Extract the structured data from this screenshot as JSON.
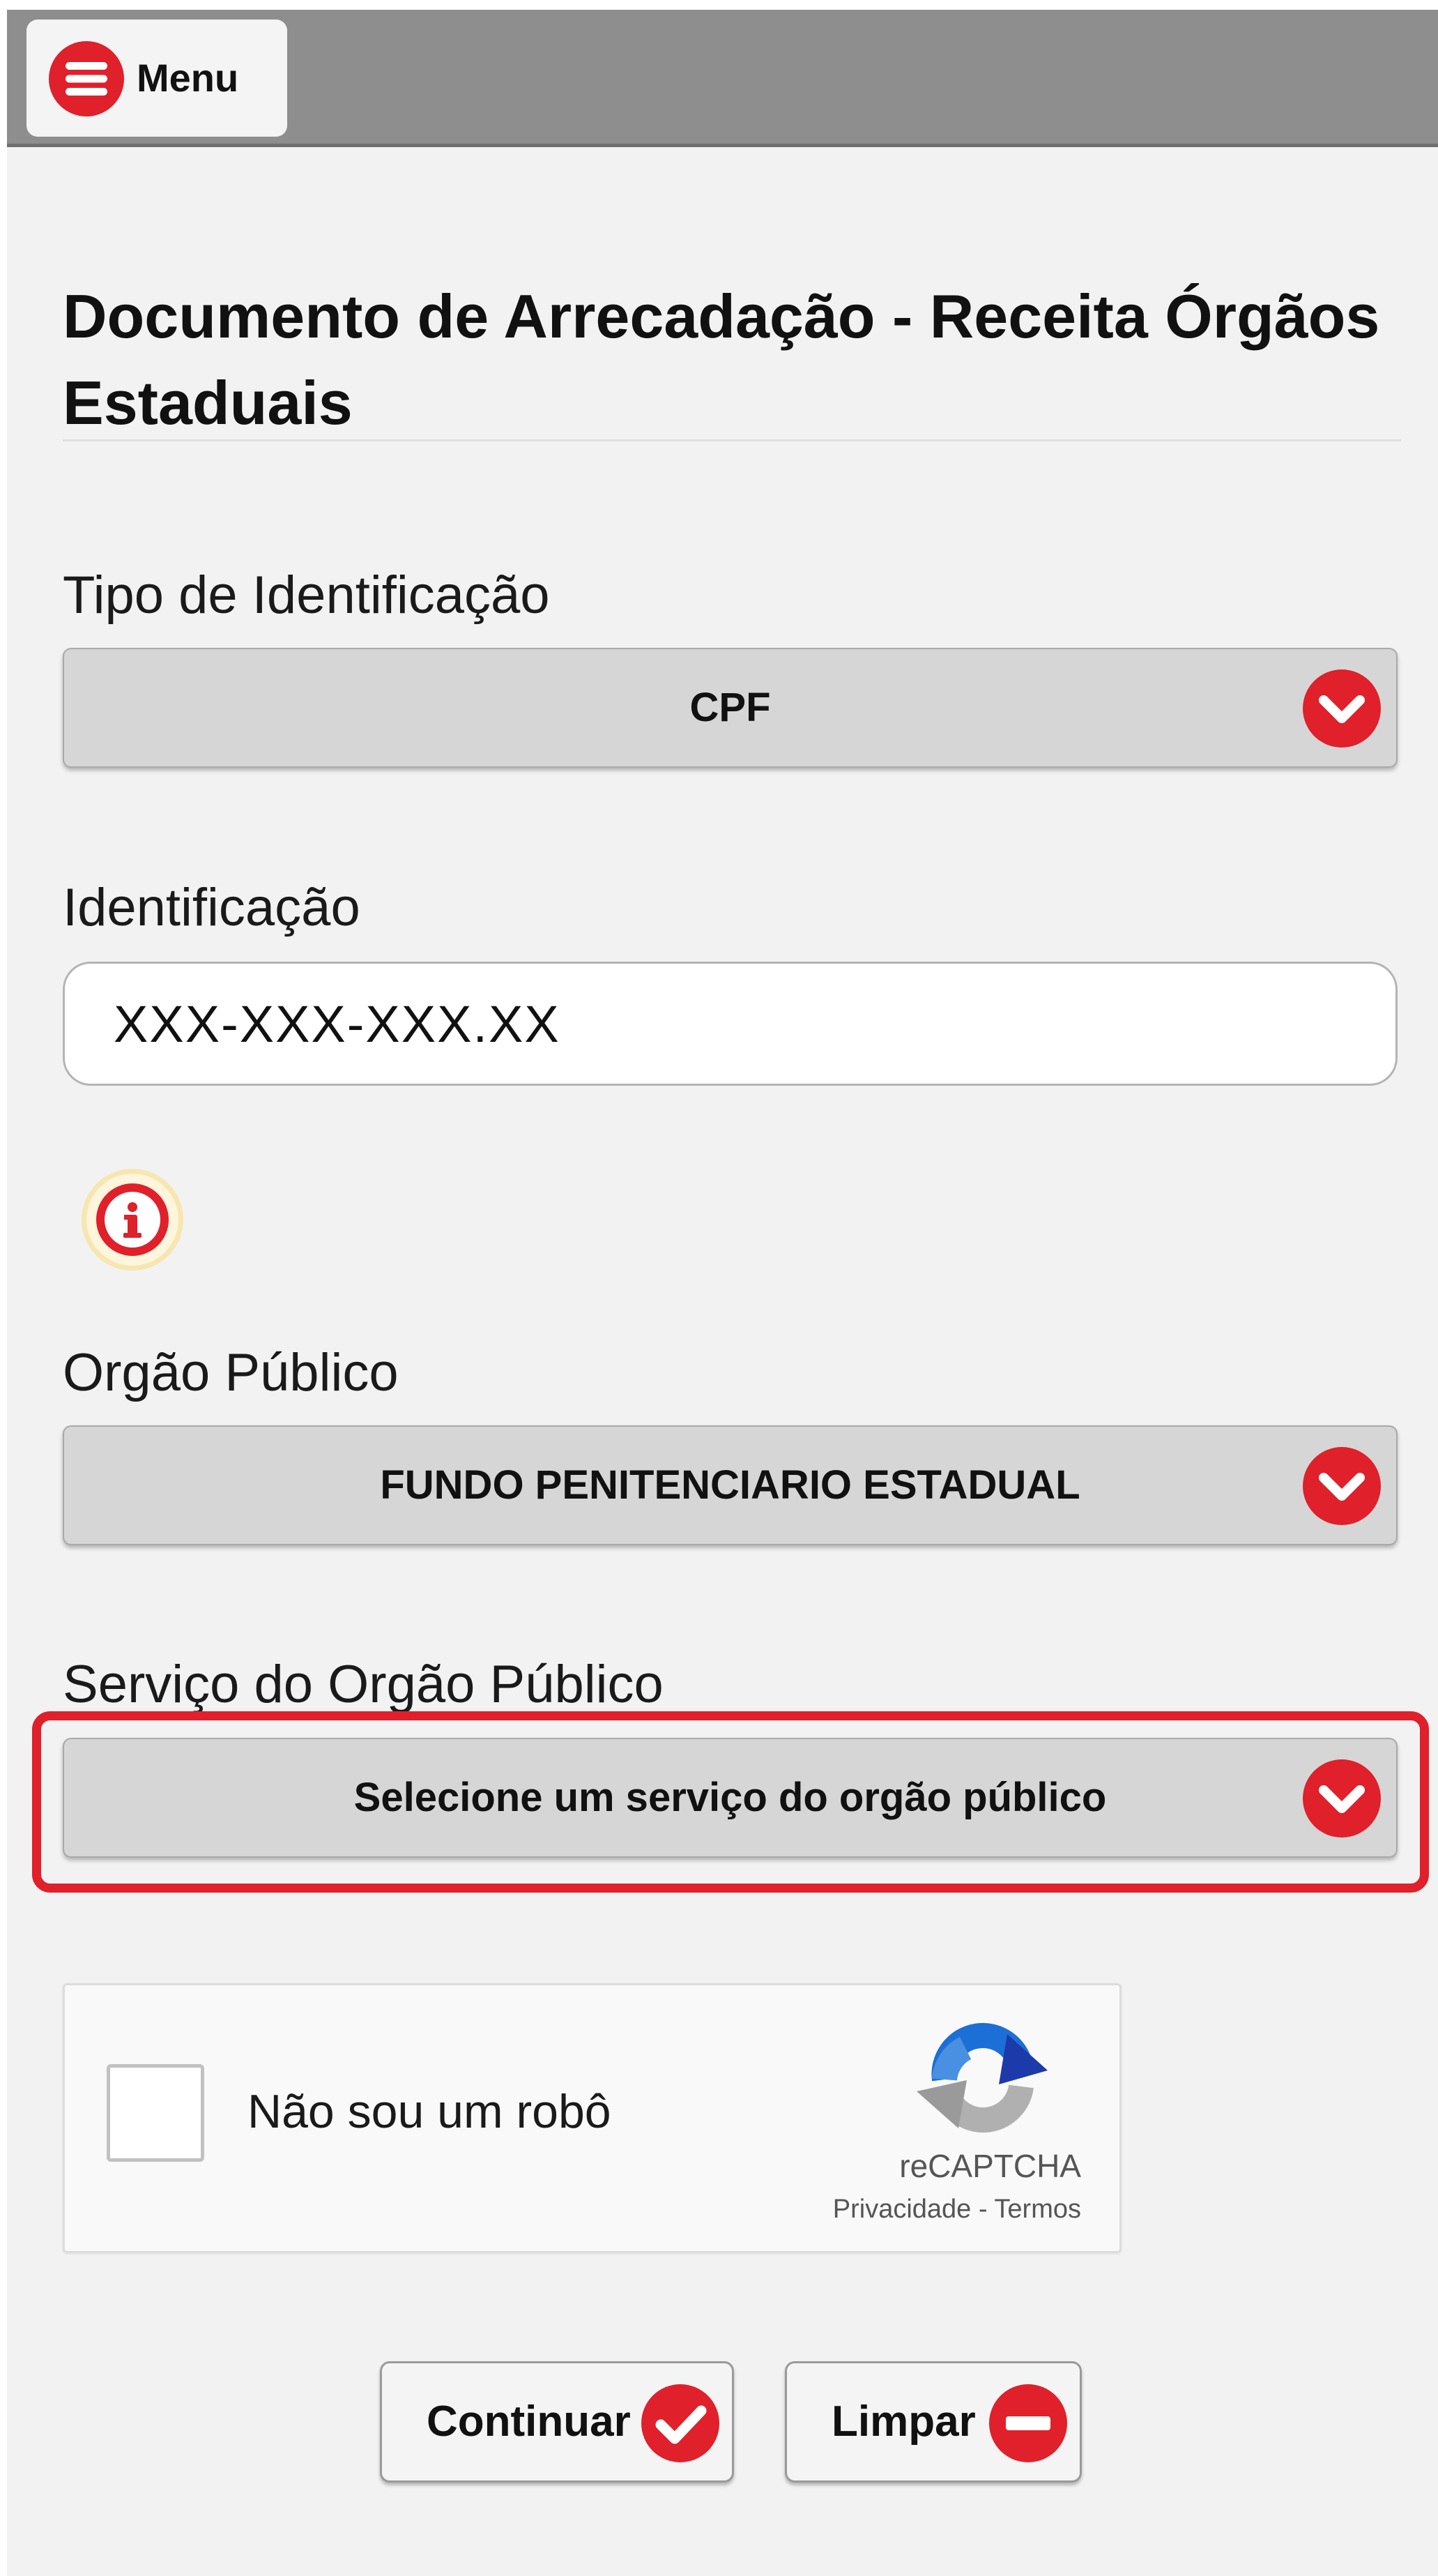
{
  "header": {
    "menu_label": "Menu"
  },
  "page": {
    "title": "Documento de Arrecadação - Receita Órgãos Estaduais"
  },
  "form": {
    "tipo_identificacao": {
      "label": "Tipo de Identificação",
      "selected": "CPF"
    },
    "identificacao": {
      "label": "Identificação",
      "value": "XXX-XXX-XXX.XX"
    },
    "orgao_publico": {
      "label": "Orgão Público",
      "selected": "FUNDO PENITENCIARIO ESTADUAL"
    },
    "servico_orgao": {
      "label": "Serviço do Orgão Público",
      "selected": "Selecione um serviço do orgão público"
    }
  },
  "captcha": {
    "label": "Não sou um robô",
    "brand": "reCAPTCHA",
    "privacy": "Privacidade",
    "separator": " - ",
    "terms": "Termos"
  },
  "actions": {
    "continue_label": "Continuar",
    "clear_label": "Limpar"
  },
  "colors": {
    "accent": "#e0202a",
    "header_bg": "#8e8e8e",
    "page_bg": "#f2f2f2",
    "select_bg": "#d6d6d6"
  },
  "icons": {
    "menu": "menu-icon",
    "chevron": "chevron-down-icon",
    "info": "info-icon",
    "confirm": "check-icon",
    "clear": "minus-icon",
    "recaptcha": "recaptcha-logo-icon"
  }
}
